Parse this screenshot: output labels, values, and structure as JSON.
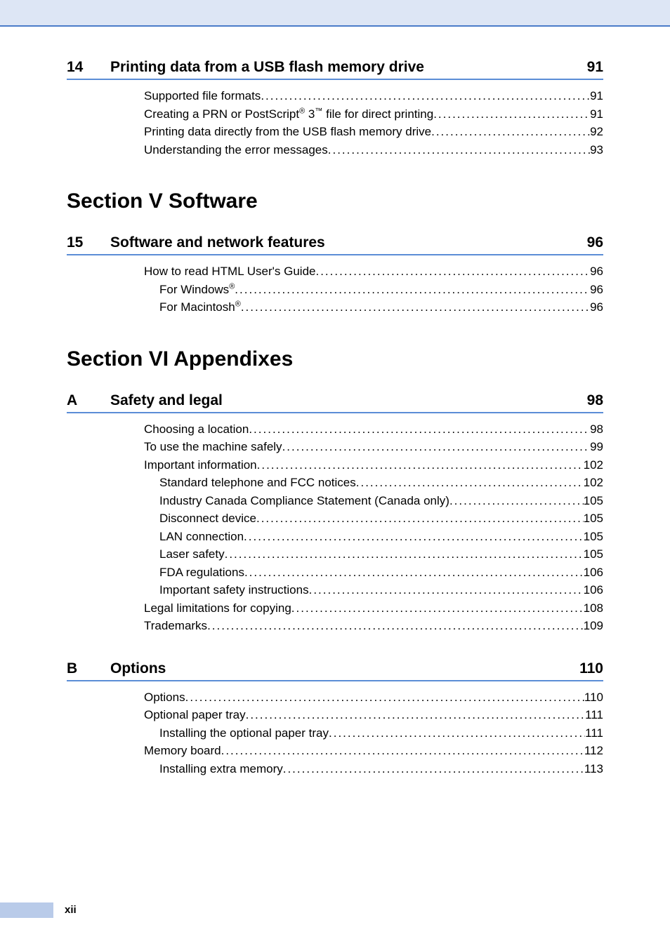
{
  "chapters": [
    {
      "num": "14",
      "title": "Printing data from a USB flash memory drive",
      "page": "91",
      "entries": [
        {
          "label": "Supported file formats",
          "page": "91",
          "indent": 0
        },
        {
          "label": "Creating a PRN or PostScript",
          "sup1": "®",
          "mid": " 3",
          "sup2": "™",
          "tail": " file for direct printing",
          "page": "91",
          "indent": 0
        },
        {
          "label": "Printing data directly from the USB flash memory drive ",
          "page": "92",
          "indent": 0
        },
        {
          "label": "Understanding the error messages ",
          "page": "93",
          "indent": 0
        }
      ]
    }
  ],
  "sectionV": "Section V  Software",
  "chapters2": [
    {
      "num": "15",
      "title": "Software and network features",
      "page": "96",
      "entries": [
        {
          "label": "How to read HTML User's Guide",
          "page": "96",
          "indent": 0
        },
        {
          "label": "For Windows",
          "sup1": "®",
          "page": "96",
          "indent": 1
        },
        {
          "label": "For Macintosh",
          "sup1": "®",
          "page": "96",
          "indent": 1
        }
      ]
    }
  ],
  "sectionVI": "Section VI Appendixes",
  "chapters3": [
    {
      "num": "A",
      "title": "Safety and legal",
      "page": "98",
      "entries": [
        {
          "label": "Choosing a location ",
          "page": "98",
          "indent": 0
        },
        {
          "label": "To use the machine safely",
          "page": "99",
          "indent": 0
        },
        {
          "label": "Important information",
          "page": "102",
          "indent": 0
        },
        {
          "label": "Standard telephone and FCC notices ",
          "page": "102",
          "indent": 1
        },
        {
          "label": "Industry Canada Compliance Statement (Canada only) ",
          "page": "105",
          "indent": 1
        },
        {
          "label": "Disconnect device ",
          "page": "105",
          "indent": 1
        },
        {
          "label": "LAN connection ",
          "page": "105",
          "indent": 1
        },
        {
          "label": "Laser safety ",
          "page": "105",
          "indent": 1
        },
        {
          "label": "FDA regulations",
          "page": "106",
          "indent": 1
        },
        {
          "label": "Important safety instructions",
          "page": "106",
          "indent": 1
        },
        {
          "label": "Legal limitations for copying ",
          "page": "108",
          "indent": 0
        },
        {
          "label": "Trademarks",
          "page": "109",
          "indent": 0
        }
      ]
    },
    {
      "num": "B",
      "title": "Options",
      "page": "110",
      "entries": [
        {
          "label": "Options ",
          "page": "110",
          "indent": 0
        },
        {
          "label": "Optional paper tray ",
          "page": "111",
          "indent": 0
        },
        {
          "label": "Installing the optional paper tray",
          "page": "111",
          "indent": 1
        },
        {
          "label": "Memory board",
          "page": "112",
          "indent": 0
        },
        {
          "label": "Installing extra memory ",
          "page": "113",
          "indent": 1
        }
      ]
    }
  ],
  "pageNumber": "xii",
  "dots": "..........................................................................................................................................."
}
